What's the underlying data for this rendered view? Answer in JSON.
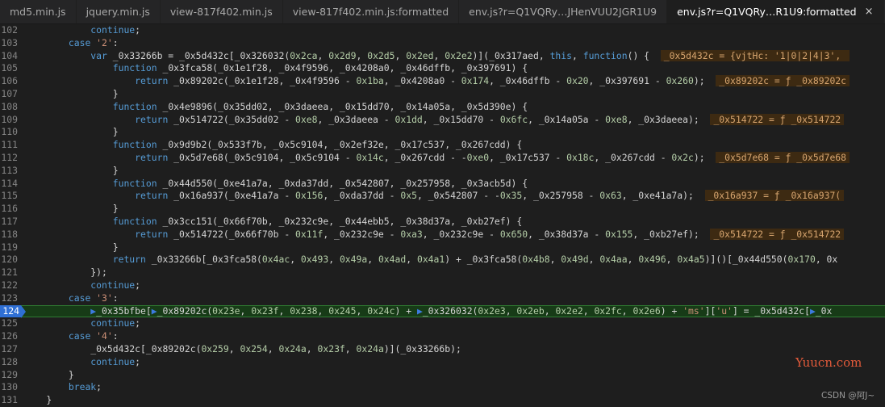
{
  "tabs": [
    {
      "label": "md5.min.js",
      "active": false
    },
    {
      "label": "jquery.min.js",
      "active": false
    },
    {
      "label": "view-817f402.min.js",
      "active": false
    },
    {
      "label": "view-817f402.min.js:formatted",
      "active": false
    },
    {
      "label": "env.js?r=Q1VQRy…JHenVUU2JGR1U9",
      "active": false
    },
    {
      "label": "env.js?r=Q1VQRy…R1U9:formatted",
      "active": true
    }
  ],
  "tab_close_glyph": "×",
  "tab_more_glyph": "»",
  "editor": {
    "current_line": 124,
    "lines": [
      {
        "n": "102",
        "code": "            continue;"
      },
      {
        "n": "103",
        "code": "        case '2':"
      },
      {
        "n": "104",
        "code": "            var _0x33266b = _0x5d432c[_0x326032(0x2ca, 0x2d9, 0x2d5, 0x2ed, 0x2e2)](_0x317aed, this, function() {  ",
        "hint": "_0x5d432c = {vjtHc: '1|0|2|4|3', "
      },
      {
        "n": "105",
        "code": "                function _0x3fca58(_0x1e1f28, _0x4f9596, _0x4208a0, _0x46dffb, _0x397691) {"
      },
      {
        "n": "106",
        "code": "                    return _0x89202c(_0x1e1f28, _0x4f9596 - 0x1ba, _0x4208a0 - 0x174, _0x46dffb - 0x20, _0x397691 - 0x260);  ",
        "hint": "_0x89202c = ƒ _0x89202c"
      },
      {
        "n": "107",
        "code": "                }"
      },
      {
        "n": "108",
        "code": "                function _0x4e9896(_0x35dd02, _0x3daeea, _0x15dd70, _0x14a05a, _0x5d390e) {"
      },
      {
        "n": "109",
        "code": "                    return _0x514722(_0x35dd02 - 0xe8, _0x3daeea - 0x1dd, _0x15dd70 - 0x6fc, _0x14a05a - 0xe8, _0x3daeea);  ",
        "hint": "_0x514722 = ƒ _0x514722"
      },
      {
        "n": "110",
        "code": "                }"
      },
      {
        "n": "111",
        "code": "                function _0x9d9b2(_0x533f7b, _0x5c9104, _0x2ef32e, _0x17c537, _0x267cdd) {"
      },
      {
        "n": "112",
        "code": "                    return _0x5d7e68(_0x5c9104, _0x5c9104 - 0x14c, _0x267cdd - -0xe0, _0x17c537 - 0x18c, _0x267cdd - 0x2c);  ",
        "hint": "_0x5d7e68 = ƒ _0x5d7e68"
      },
      {
        "n": "113",
        "code": "                }"
      },
      {
        "n": "114",
        "code": "                function _0x44d550(_0xe41a7a, _0xda37dd, _0x542807, _0x257958, _0x3acb5d) {"
      },
      {
        "n": "115",
        "code": "                    return _0x16a937(_0xe41a7a - 0x156, _0xda37dd - 0x5, _0x542807 - -0x35, _0x257958 - 0x63, _0xe41a7a);  ",
        "hint": "_0x16a937 = ƒ _0x16a937("
      },
      {
        "n": "116",
        "code": "                }"
      },
      {
        "n": "117",
        "code": "                function _0x3cc151(_0x66f70b, _0x232c9e, _0x44ebb5, _0x38d37a, _0xb27ef) {"
      },
      {
        "n": "118",
        "code": "                    return _0x514722(_0x66f70b - 0x11f, _0x232c9e - 0xa3, _0x232c9e - 0x650, _0x38d37a - 0x155, _0xb27ef);  ",
        "hint": "_0x514722 = ƒ _0x514722"
      },
      {
        "n": "119",
        "code": "                }"
      },
      {
        "n": "120",
        "code": "                return _0x33266b[_0x3fca58(0x4ac, 0x493, 0x49a, 0x4ad, 0x4a1) + _0x3fca58(0x4b8, 0x49d, 0x4aa, 0x496, 0x4a5)]()[_0x44d550(0x170, 0x"
      },
      {
        "n": "121",
        "code": "            });"
      },
      {
        "n": "122",
        "code": "            continue;"
      },
      {
        "n": "123",
        "code": "        case '3':"
      },
      {
        "n": "124",
        "code": "            ▶_0x35bfbe[▶_0x89202c(0x23e, 0x23f, 0x238, 0x245, 0x24c) + ▶_0x326032(0x2e3, 0x2eb, 0x2e2, 0x2fc, 0x2e6) + 'ms']['u'] = _0x5d432c[▶_0x"
      },
      {
        "n": "125",
        "code": "            continue;"
      },
      {
        "n": "126",
        "code": "        case '4':"
      },
      {
        "n": "127",
        "code": "            _0x5d432c[_0x89202c(0x259, 0x254, 0x24a, 0x23f, 0x24a)](_0x33266b);"
      },
      {
        "n": "128",
        "code": "            continue;"
      },
      {
        "n": "129",
        "code": "        }"
      },
      {
        "n": "130",
        "code": "        break;"
      },
      {
        "n": "131",
        "code": "    }"
      }
    ]
  },
  "watermark_site": "Yuucn.com",
  "watermark_csdn": "CSDN @阿J~",
  "colors": {
    "background": "#1e1e1e",
    "keyword": "#569cd6",
    "number": "#b5cea8",
    "string": "#ce9178",
    "current_line": "#173b17",
    "breakpoint": "#2f6fd4",
    "hint": "#3d2a12"
  }
}
